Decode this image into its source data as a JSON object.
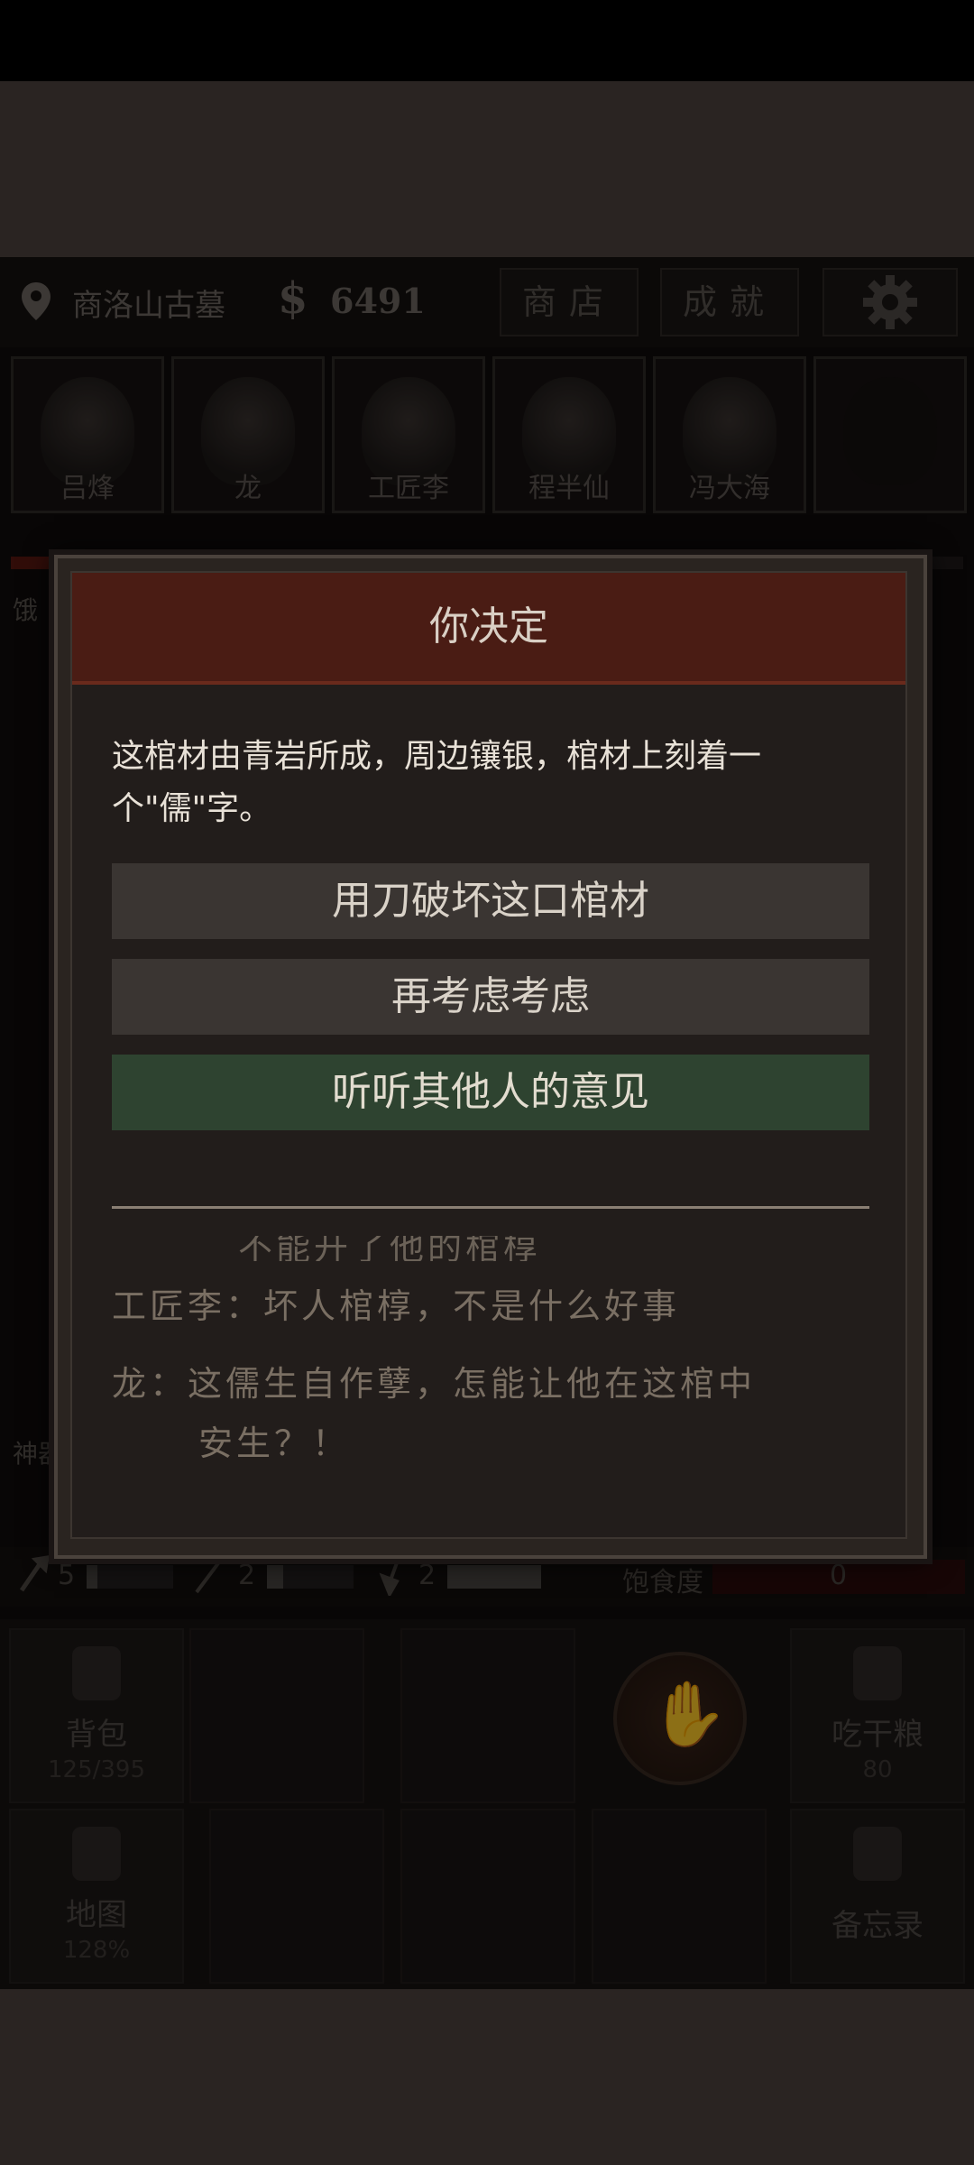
{
  "header": {
    "location": "商洛山古墓",
    "money_symbol": "$",
    "money": "6491",
    "shop_label": "商店",
    "achievements_label": "成就"
  },
  "portraits": [
    {
      "name": "吕烽"
    },
    {
      "name": "龙"
    },
    {
      "name": "工匠李"
    },
    {
      "name": "程半仙"
    },
    {
      "name": "冯大海"
    },
    {
      "name": ""
    }
  ],
  "side": {
    "hunger_tag": "饿",
    "shen_tag": "神器"
  },
  "stats": {
    "tool1": "5",
    "tool2": "2",
    "tool3": "2",
    "satiety_label": "饱食度",
    "satiety_value": "0"
  },
  "panel": {
    "backpack_label": "背包",
    "backpack_count": "125/395",
    "ration_label": "吃干粮",
    "ration_count": "80",
    "map_label": "地图",
    "map_percent": "128%",
    "memo_label": "备忘录"
  },
  "dialog": {
    "title": "你决定",
    "description": "这棺材由青岩所成，周边镶银，棺材上刻着一个\"儒\"字。",
    "options": [
      {
        "label": "用刀破坏这口棺材"
      },
      {
        "label": "再考虑考虑"
      },
      {
        "label": "听听其他人的意见"
      }
    ],
    "log_cut": "不能开了他的棺椁",
    "log": [
      {
        "speaker": "工匠李：",
        "text": "坏人棺椁，不是什么好事"
      },
      {
        "speaker": "龙：",
        "text": "这儒生自作孽，怎能让他在这棺中",
        "cont": "安生？！"
      }
    ]
  }
}
